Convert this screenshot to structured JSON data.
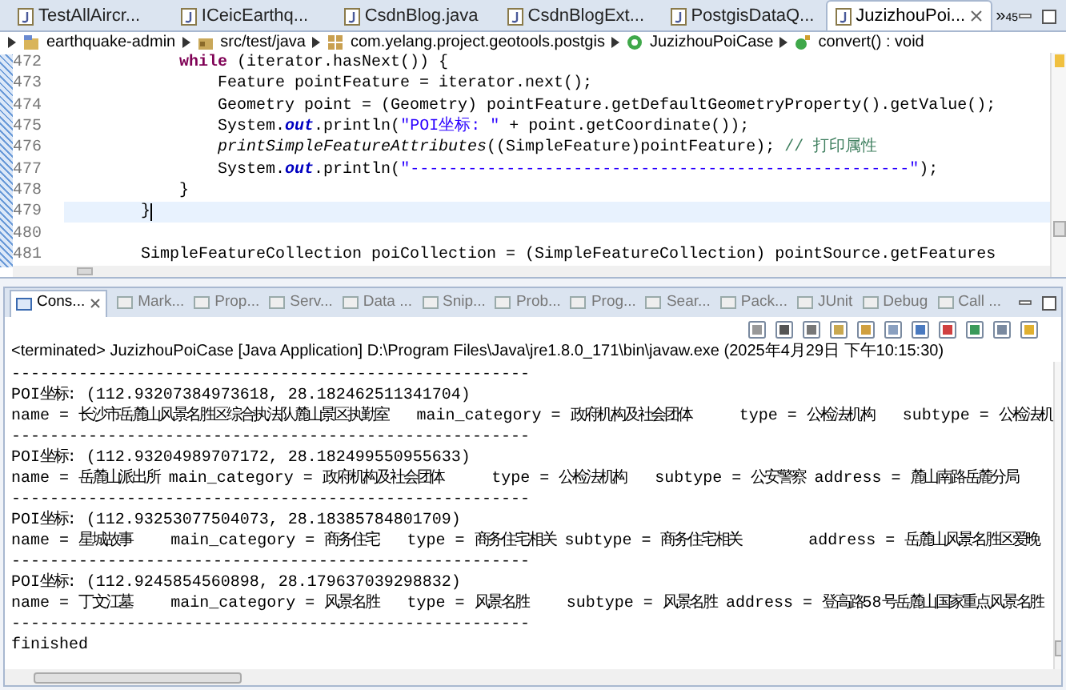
{
  "editor_tabs": [
    {
      "label": "TestAllAircr...",
      "selected": false
    },
    {
      "label": "ICeicEarthq...",
      "selected": false
    },
    {
      "label": "CsdnBlog.java",
      "selected": false
    },
    {
      "label": "CsdnBlogExt...",
      "selected": false
    },
    {
      "label": "PostgisDataQ...",
      "selected": false
    },
    {
      "label": "JuzizhouPoi...",
      "selected": true
    }
  ],
  "tab_overflow": {
    "symbol": "»",
    "count": "45"
  },
  "breadcrumb": [
    {
      "label": "earthquake-admin",
      "kind": "project"
    },
    {
      "label": "src/test/java",
      "kind": "folder"
    },
    {
      "label": "com.yelang.project.geotools.postgis",
      "kind": "package"
    },
    {
      "label": "JuzizhouPoiCase",
      "kind": "class"
    },
    {
      "label": "convert() : void",
      "kind": "method"
    }
  ],
  "editor_lines": [
    {
      "number": "472",
      "current": false,
      "tokens": [
        {
          "text": "            while",
          "kind": "keyword"
        },
        {
          "text": " (iterator.hasNext()) {",
          "kind": "plain"
        }
      ]
    },
    {
      "number": "473",
      "current": false,
      "tokens": [
        {
          "text": "                Feature pointFeature = iterator.next();",
          "kind": "plain"
        }
      ]
    },
    {
      "number": "474",
      "current": false,
      "tokens": [
        {
          "text": "                Geometry point = (Geometry) pointFeature.getDefaultGeometryProperty().getValue();",
          "kind": "plain"
        }
      ]
    },
    {
      "number": "475",
      "current": false,
      "tokens": [
        {
          "text": "                System.",
          "kind": "plain"
        },
        {
          "text": "out",
          "kind": "field"
        },
        {
          "text": ".println(",
          "kind": "plain"
        },
        {
          "text": "\"POI坐标: \"",
          "kind": "string"
        },
        {
          "text": " + point.getCoordinate());",
          "kind": "plain"
        }
      ]
    },
    {
      "number": "476",
      "current": false,
      "tokens": [
        {
          "text": "                printSimpleFeatureAttributes",
          "kind": "static"
        },
        {
          "text": "((SimpleFeature)pointFeature); ",
          "kind": "plain"
        },
        {
          "text": "// 打印属性",
          "kind": "comment"
        }
      ]
    },
    {
      "number": "477",
      "current": false,
      "tokens": [
        {
          "text": "                System.",
          "kind": "plain"
        },
        {
          "text": "out",
          "kind": "field"
        },
        {
          "text": ".println(",
          "kind": "plain"
        },
        {
          "text": "\"----------------------------------------------------\"",
          "kind": "string"
        },
        {
          "text": ");",
          "kind": "plain"
        }
      ]
    },
    {
      "number": "478",
      "current": false,
      "tokens": [
        {
          "text": "            }",
          "kind": "plain"
        }
      ]
    },
    {
      "number": "479",
      "current": true,
      "tokens": [
        {
          "text": "        }",
          "kind": "plain"
        }
      ]
    },
    {
      "number": "480",
      "current": false
    },
    {
      "number": "481",
      "current": false,
      "tokens": [
        {
          "text": "        SimpleFeatureCollection poiCollection = (SimpleFeatureCollection) pointSource.getFeatures",
          "kind": "plain"
        }
      ]
    }
  ],
  "view_tabs": [
    {
      "label": "Cons...",
      "selected": true
    },
    {
      "label": "Mark...",
      "selected": false
    },
    {
      "label": "Prop...",
      "selected": false
    },
    {
      "label": "Serv...",
      "selected": false
    },
    {
      "label": "Data ...",
      "selected": false
    },
    {
      "label": "Snip...",
      "selected": false
    },
    {
      "label": "Prob...",
      "selected": false
    },
    {
      "label": "Prog...",
      "selected": false
    },
    {
      "label": "Sear...",
      "selected": false
    },
    {
      "label": "Pack...",
      "selected": false
    },
    {
      "label": "JUnit",
      "selected": false
    },
    {
      "label": "Debug",
      "selected": false
    },
    {
      "label": "Call ...",
      "selected": false
    }
  ],
  "console": {
    "header": "<terminated> JuzizhouPoiCase [Java Application] D:\\Program Files\\Java\\jre1.8.0_171\\bin\\javaw.exe (2025年4月29日 下午10:15:30)",
    "lines": [
      "------------------------------------------------------",
      "POI坐标: (112.93207384973618, 28.182462511341704)",
      "name = 长沙市岳麓山风景名胜区综合执法队麓山景区执勤室   main_category = 政府机构及社会团体     type = 公检法机构   subtype = 公检法机",
      "------------------------------------------------------",
      "POI坐标: (112.93204989707172, 28.182499550955633)",
      "name = 岳麓山派出所 main_category = 政府机构及社会团体     type = 公检法机构   subtype = 公安警察 address = 麓山南路岳麓分局",
      "------------------------------------------------------",
      "POI坐标: (112.93253077504073, 28.18385784801709)",
      "name = 星城故事    main_category = 商务住宅   type = 商务住宅相关 subtype = 商务住宅相关       address = 岳麓山风景名胜区爱晚",
      "------------------------------------------------------",
      "POI坐标: (112.9245854560898, 28.179637039298832)",
      "name = 丁文江墓    main_category = 风景名胜   type = 风景名胜    subtype = 风景名胜 address = 登高路58号岳麓山国家重点风景名胜",
      "------------------------------------------------------",
      "finished"
    ]
  }
}
